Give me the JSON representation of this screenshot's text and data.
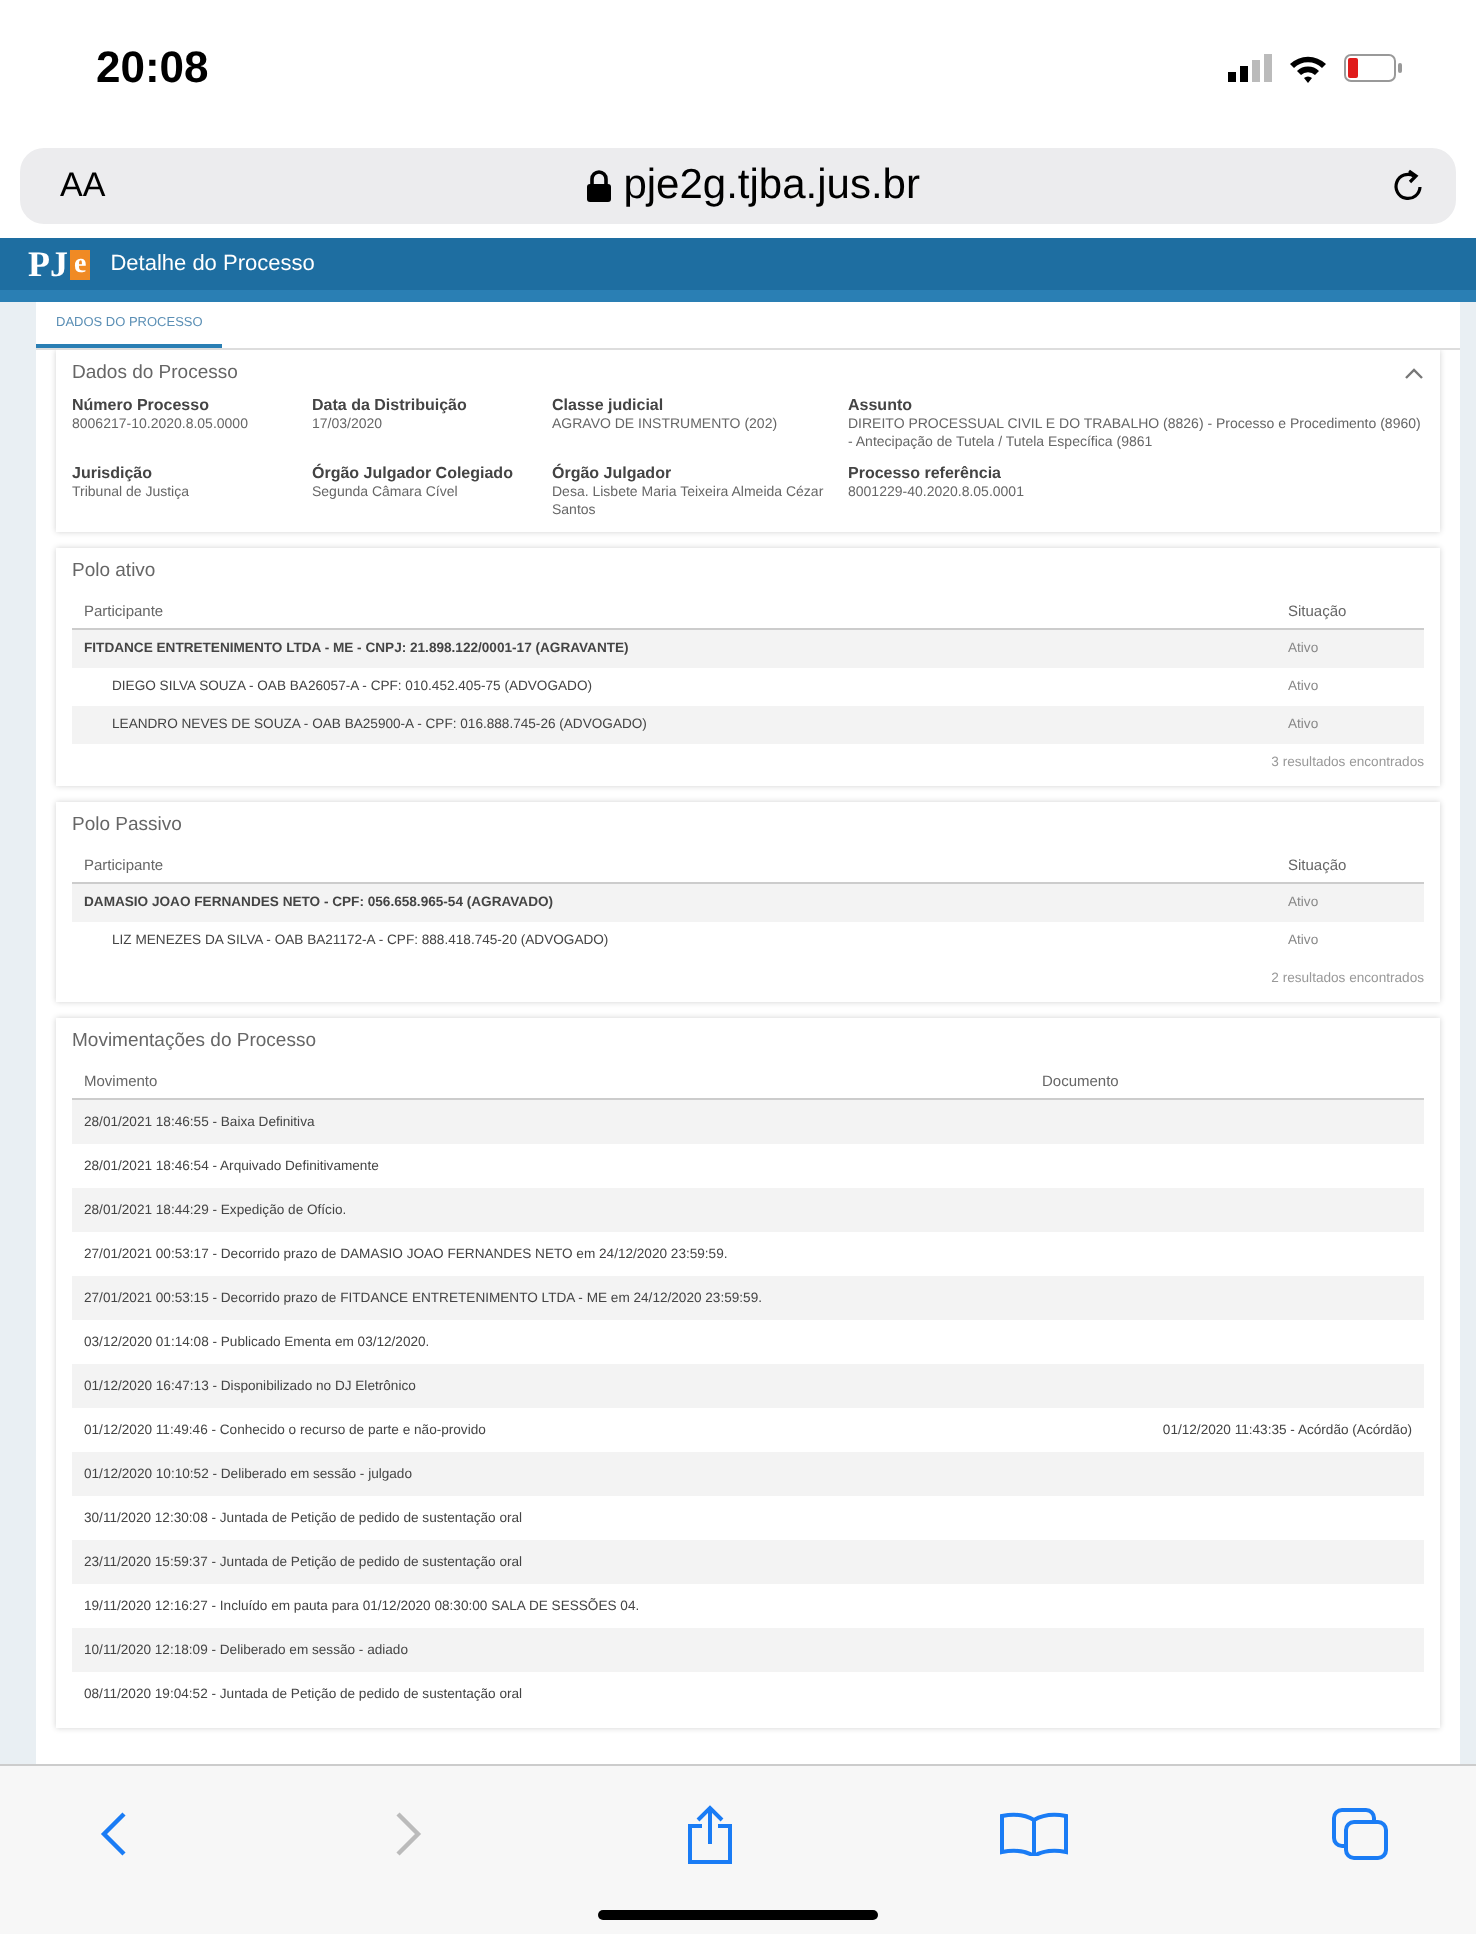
{
  "status_bar": {
    "time": "20:08"
  },
  "browser": {
    "text_size_button": "AA",
    "url": "pje2g.tjba.jus.br"
  },
  "app_header": {
    "logo_main": "PJ",
    "logo_accent": "e",
    "title": "Detalhe do Processo"
  },
  "tabs": [
    {
      "label": "DADOS DO PROCESSO",
      "selected": true
    }
  ],
  "details": {
    "title": "Dados do Processo",
    "expanded": true,
    "fields": [
      {
        "label": "Número Processo",
        "value": "8006217-10.2020.8.05.0000"
      },
      {
        "label": "Data da Distribuição",
        "value": "17/03/2020"
      },
      {
        "label": "Classe judicial",
        "value": "AGRAVO DE INSTRUMENTO (202)"
      },
      {
        "label": "Assunto",
        "value": "DIREITO PROCESSUAL CIVIL E DO TRABALHO (8826) - Processo e Procedimento (8960) - Antecipação de Tutela / Tutela Específica (9861"
      },
      {
        "label": "Jurisdição",
        "value": "Tribunal de Justiça"
      },
      {
        "label": "Órgão Julgador Colegiado",
        "value": "Segunda Câmara Cível"
      },
      {
        "label": "Órgão Julgador",
        "value": "Desa. Lisbete Maria Teixeira Almeida Cézar Santos"
      },
      {
        "label": "Processo referência",
        "value": "8001229-40.2020.8.05.0001"
      }
    ]
  },
  "polo_ativo": {
    "title": "Polo ativo",
    "columns": [
      "Participante",
      "Situação"
    ],
    "rows": [
      {
        "kind": "party",
        "participant": "FITDANCE ENTRETENIMENTO LTDA - ME - CNPJ: 21.898.122/0001-17 (AGRAVANTE)",
        "status": "Ativo"
      },
      {
        "kind": "lawyer",
        "participant": "DIEGO SILVA SOUZA - OAB BA26057-A - CPF: 010.452.405-75 (ADVOGADO)",
        "status": "Ativo"
      },
      {
        "kind": "lawyer",
        "participant": "LEANDRO NEVES DE SOUZA - OAB BA25900-A - CPF: 016.888.745-26 (ADVOGADO)",
        "status": "Ativo"
      }
    ],
    "footer": "3 resultados encontrados"
  },
  "polo_passivo": {
    "title": "Polo Passivo",
    "columns": [
      "Participante",
      "Situação"
    ],
    "rows": [
      {
        "kind": "party",
        "participant": "DAMASIO JOAO FERNANDES NETO - CPF: 056.658.965-54 (AGRAVADO)",
        "status": "Ativo"
      },
      {
        "kind": "lawyer",
        "participant": "LIZ MENEZES DA SILVA - OAB BA21172-A - CPF: 888.418.745-20 (ADVOGADO)",
        "status": "Ativo"
      }
    ],
    "footer": "2 resultados encontrados"
  },
  "movimentacoes": {
    "title": "Movimentações do Processo",
    "columns": [
      "Movimento",
      "Documento"
    ],
    "rows": [
      {
        "movement": "28/01/2021 18:46:55 - Baixa Definitiva"
      },
      {
        "movement": "28/01/2021 18:46:54 - Arquivado Definitivamente"
      },
      {
        "movement": "28/01/2021 18:44:29 - Expedição de Ofício."
      },
      {
        "movement": "27/01/2021 00:53:17 - Decorrido prazo de DAMASIO JOAO FERNANDES NETO em 24/12/2020 23:59:59."
      },
      {
        "movement": "27/01/2021 00:53:15 - Decorrido prazo de FITDANCE ENTRETENIMENTO LTDA - ME em 24/12/2020 23:59:59."
      },
      {
        "movement": "03/12/2020 01:14:08 - Publicado Ementa em 03/12/2020."
      },
      {
        "movement": "01/12/2020 16:47:13 - Disponibilizado no DJ Eletrônico"
      },
      {
        "movement": "01/12/2020 11:49:46 - Conhecido o recurso de parte e não-provido",
        "document": "01/12/2020 11:43:35 - Acórdão (Acórdão)"
      },
      {
        "movement": "01/12/2020 10:10:52 - Deliberado em sessão - julgado"
      },
      {
        "movement": "30/11/2020 12:30:08 - Juntada de Petição de pedido de sustentação oral"
      },
      {
        "movement": "23/11/2020 15:59:37 - Juntada de Petição de pedido de sustentação oral"
      },
      {
        "movement": "19/11/2020 12:16:27 - Incluído em pauta para 01/12/2020 08:30:00 SALA DE SESSÕES 04."
      },
      {
        "movement": "10/11/2020 12:18:09 - Deliberado em sessão - adiado"
      },
      {
        "movement": "08/11/2020 19:04:52 - Juntada de Petição de pedido de sustentação oral"
      }
    ]
  },
  "toolbar": {
    "back_enabled": true,
    "forward_enabled": false
  }
}
